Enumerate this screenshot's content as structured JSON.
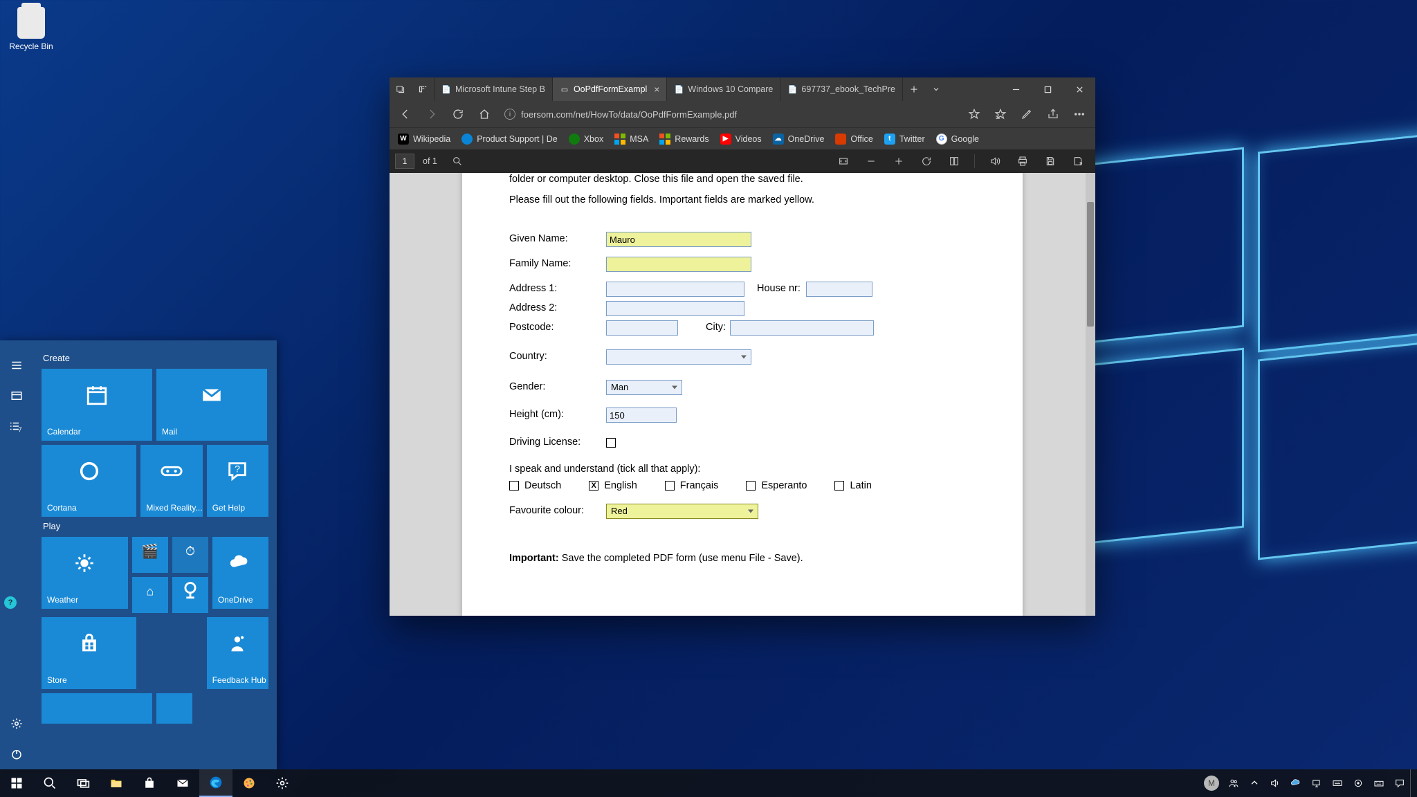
{
  "desktop": {
    "recycle_bin": "Recycle Bin"
  },
  "start": {
    "group_create": "Create",
    "group_play": "Play",
    "tiles": {
      "calendar": "Calendar",
      "mail": "Mail",
      "cortana": "Cortana",
      "mixed_reality": "Mixed Reality...",
      "get_help": "Get Help",
      "weather": "Weather",
      "onedrive": "OneDrive",
      "store": "Store",
      "feedback_hub": "Feedback Hub"
    }
  },
  "edge": {
    "tabs": {
      "t1": "Microsoft Intune Step B",
      "t2": "OoPdfFormExampl",
      "t3": "Windows 10 Compare",
      "t4": "697737_ebook_TechPre"
    },
    "url": "foersom.com/net/HowTo/data/OoPdfFormExample.pdf",
    "favorites": {
      "wikipedia": "Wikipedia",
      "product_support": "Product Support | De",
      "xbox": "Xbox",
      "msa": "MSA",
      "rewards": "Rewards",
      "videos": "Videos",
      "onedrive": "OneDrive",
      "office": "Office",
      "twitter": "Twitter",
      "google": "Google"
    },
    "pdfbar": {
      "page": "1",
      "of": "of 1"
    }
  },
  "pdf": {
    "line1": "folder or computer desktop. Close this file and open the saved file.",
    "line2": "Please fill out the following fields. Important fields are marked yellow.",
    "labels": {
      "given_name": "Given Name:",
      "family_name": "Family Name:",
      "address1": "Address 1:",
      "address2": "Address 2:",
      "house_nr": "House nr:",
      "postcode": "Postcode:",
      "city": "City:",
      "country": "Country:",
      "gender": "Gender:",
      "height": "Height (cm):",
      "driving": "Driving License:",
      "languages_hdr": "I speak and understand (tick all that apply):",
      "fav_colour": "Favourite colour:"
    },
    "values": {
      "given_name": "Mauro",
      "gender": "Man",
      "height": "150",
      "fav_colour": "Red"
    },
    "languages": {
      "deutsch": "Deutsch",
      "english": "English",
      "francais": "Français",
      "esperanto": "Esperanto",
      "latin": "Latin",
      "english_checked": "X"
    },
    "important_label": "Important:",
    "important_text": " Save the completed PDF form (use menu File - Save)."
  },
  "taskbar": {
    "avatar_letter": "M"
  }
}
